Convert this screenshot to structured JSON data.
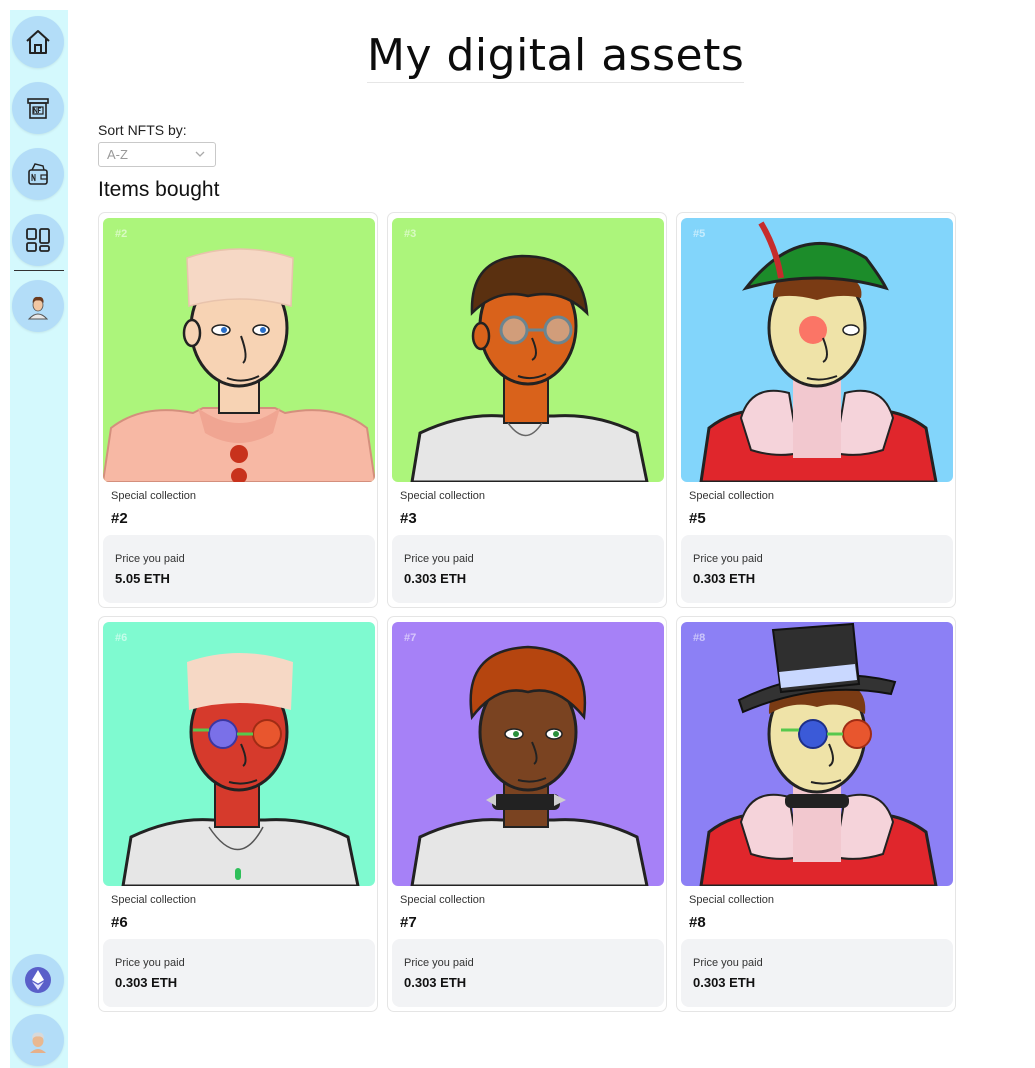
{
  "page": {
    "title": "My digital assets",
    "sort_label": "Sort NFTS by:",
    "sort_selected": "A-Z",
    "section_title": "Items bought"
  },
  "sidebar": {
    "items": [
      {
        "name": "home",
        "icon": "home-icon"
      },
      {
        "name": "marketplace",
        "icon": "nft-shop-icon"
      },
      {
        "name": "wallet",
        "icon": "nft-wallet-icon"
      },
      {
        "name": "dashboard",
        "icon": "dashboard-grid-icon"
      },
      {
        "name": "profile",
        "icon": "avatar-icon"
      }
    ],
    "bottom": [
      {
        "name": "ethereum",
        "icon": "ethereum-icon"
      },
      {
        "name": "account",
        "icon": "account-avatar-icon"
      }
    ]
  },
  "items": [
    {
      "num": "#2",
      "collection": "Special collection",
      "name": "#2",
      "price_label": "Price you paid",
      "price": "5.05 ETH",
      "bg": "#acf57b"
    },
    {
      "num": "#3",
      "collection": "Special collection",
      "name": "#3",
      "price_label": "Price you paid",
      "price": "0.303 ETH",
      "bg": "#acf57b"
    },
    {
      "num": "#5",
      "collection": "Special collection",
      "name": "#5",
      "price_label": "Price you paid",
      "price": "0.303 ETH",
      "bg": "#82d5fb"
    },
    {
      "num": "#6",
      "collection": "Special collection",
      "name": "#6",
      "price_label": "Price you paid",
      "price": "0.303 ETH",
      "bg": "#7ffad0"
    },
    {
      "num": "#7",
      "collection": "Special collection",
      "name": "#7",
      "price_label": "Price you paid",
      "price": "0.303 ETH",
      "bg": "#a681f7"
    },
    {
      "num": "#8",
      "collection": "Special collection",
      "name": "#8",
      "price_label": "Price you paid",
      "price": "0.303 ETH",
      "bg": "#8c80f5"
    }
  ],
  "colors": {
    "sidebar_bg": "#d4f9fd",
    "nav_button": "#b3ddf8",
    "price_box": "#f2f3f5"
  }
}
